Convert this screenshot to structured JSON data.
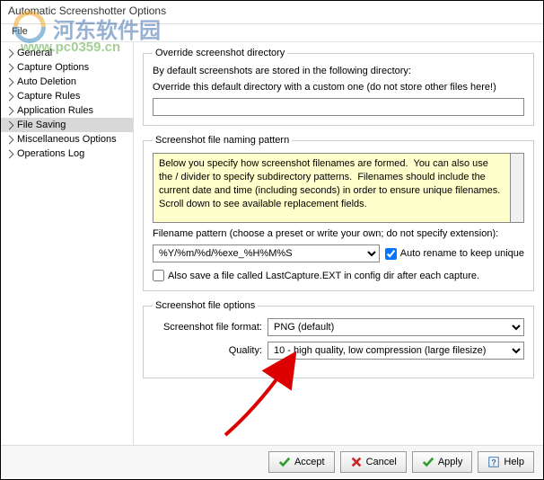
{
  "window": {
    "title": "Automatic Screenshotter Options"
  },
  "menu": {
    "file": "File"
  },
  "sidebar": {
    "items": [
      {
        "label": "General"
      },
      {
        "label": "Capture Options"
      },
      {
        "label": "Auto Deletion"
      },
      {
        "label": "Capture Rules"
      },
      {
        "label": "Application Rules"
      },
      {
        "label": "File Saving"
      },
      {
        "label": "Miscellaneous Options"
      },
      {
        "label": "Operations Log"
      }
    ]
  },
  "override": {
    "legend": "Override screenshot directory",
    "desc": "By default screenshots are stored in the following directory:",
    "instr": "Override this default directory with a custom one (do not store other files here!)",
    "value": ""
  },
  "naming": {
    "legend": "Screenshot file naming pattern",
    "help": "Below you specify how screenshot filenames are formed.  You can also use the / divider to specify subdirectory patterns.  Filenames should include the current date and time (including seconds) in order to ensure unique filenames.  Scroll down to see available replacement fields.",
    "pattern_label": "Filename pattern (choose a preset or write your own; do not specify extension):",
    "pattern_value": "%Y/%m/%d/%exe_%H%M%S",
    "auto_rename": "Auto rename to keep unique",
    "auto_rename_checked": true,
    "also_save": "Also save a file called LastCapture.EXT in config dir after each capture.",
    "also_save_checked": false
  },
  "fileopts": {
    "legend": "Screenshot file options",
    "format_label": "Screenshot file format:",
    "format_value": "PNG (default)",
    "quality_label": "Quality:",
    "quality_value": "10 - high quality, low compression (large filesize)"
  },
  "buttons": {
    "accept": "Accept",
    "cancel": "Cancel",
    "apply": "Apply",
    "help": "Help"
  },
  "watermark": {
    "site_cn": "河东软件园",
    "site_url": "www.pc0359.cn"
  }
}
